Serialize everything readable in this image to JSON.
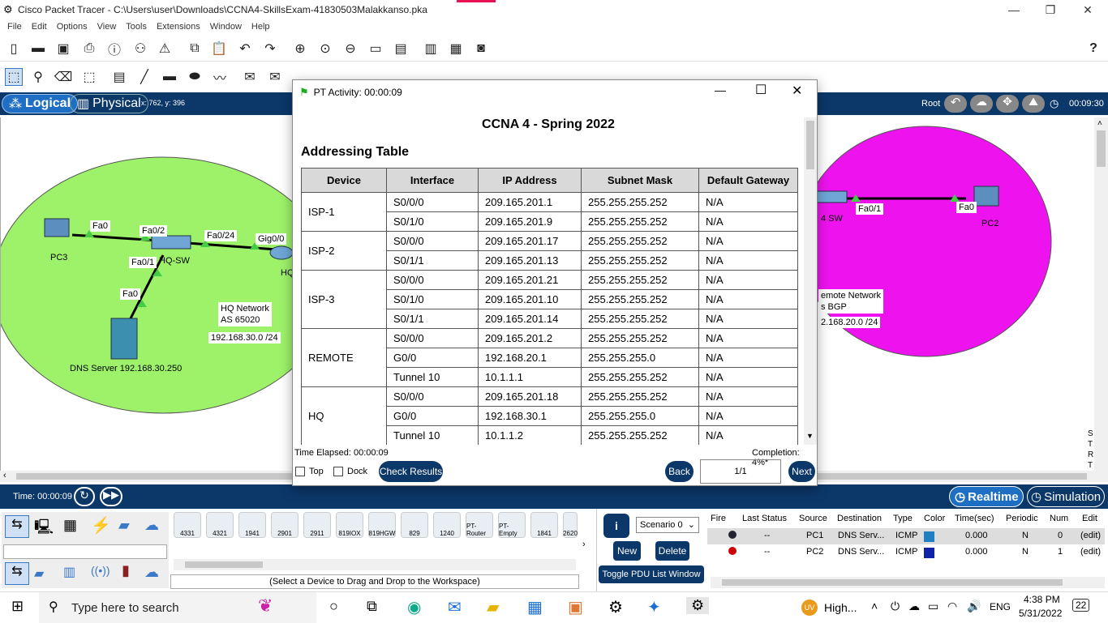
{
  "window": {
    "title": "Cisco Packet Tracer - C:\\Users\\user\\Downloads\\CCNA4-SkillsExam-41830503Malakkanso.pka",
    "min": "—",
    "restore": "❐",
    "close": "✕"
  },
  "menu": [
    "File",
    "Edit",
    "Options",
    "View",
    "Tools",
    "Extensions",
    "Window",
    "Help"
  ],
  "help_icon": "?",
  "logical": {
    "logical_label": "Logical",
    "physical_label": "Physical",
    "coords": "x: 762, y: 396",
    "root": "Root",
    "clock": "00:09:30"
  },
  "workspace": {
    "left": {
      "pc3": "PC3",
      "fa0_pc3": "Fa0",
      "fa02": "Fa0/2",
      "fa024": "Fa0/24",
      "gig00": "Gig0/0",
      "fa01": "Fa0/1",
      "hqsw": "HQ-SW",
      "hq": "HQ",
      "fa0_dns": "Fa0",
      "hqnet1": "HQ Network",
      "hqnet2": "AS 65020",
      "subnet": "192.168.30.0 /24",
      "dns": "DNS Server  192.168.30.250"
    },
    "right": {
      "sw": "4 SW",
      "fa01": "Fa0/1",
      "fa0": "Fa0",
      "pc2": "PC2",
      "remote1": "emote Network",
      "remote2": "s BGP",
      "subnet": "2.168.20.0 /24"
    },
    "side_letters": [
      "S",
      "T",
      "R",
      "T"
    ]
  },
  "timebar": {
    "time": "Time: 00:00:09",
    "realtime": "Realtime",
    "simulation": "Simulation"
  },
  "devices": [
    "4331",
    "4321",
    "1941",
    "2901",
    "2911",
    "819IOX",
    "819HGW",
    "829",
    "1240",
    "PT-Router",
    "PT-Empty",
    "1841",
    "2620"
  ],
  "device_hint": "(Select a Device to Drag and Drop to the Workspace)",
  "scenario": {
    "select": "Scenario 0",
    "new": "New",
    "delete": "Delete",
    "toggle": "Toggle PDU List Window",
    "info": "i"
  },
  "pdu": {
    "headers": [
      "Fire",
      "Last Status",
      "Source",
      "Destination",
      "Type",
      "Color",
      "Time(sec)",
      "Periodic",
      "Num",
      "Edit"
    ],
    "rows": [
      {
        "status": "--",
        "source": "PC1",
        "dest": "DNS Serv...",
        "type": "ICMP",
        "color": "#1e7fc2",
        "time": "0.000",
        "periodic": "N",
        "num": "0",
        "edit": "(edit)"
      },
      {
        "status": "--",
        "source": "PC2",
        "dest": "DNS Serv...",
        "type": "ICMP",
        "color": "#1022a8",
        "time": "0.000",
        "periodic": "N",
        "num": "1",
        "edit": "(edit)"
      }
    ]
  },
  "dialog": {
    "title": "PT Activity: 00:00:09",
    "heading": "CCNA 4 - Spring 2022",
    "section": "Addressing Table",
    "columns": [
      "Device",
      "Interface",
      "IP Address",
      "Subnet Mask",
      "Default Gateway"
    ],
    "devices": [
      {
        "name": "ISP-1",
        "rows": [
          [
            "S0/0/0",
            "209.165.201.1",
            "255.255.255.252",
            "N/A"
          ],
          [
            "S0/1/0",
            "209.165.201.9",
            "255.255.255.252",
            "N/A"
          ]
        ]
      },
      {
        "name": "ISP-2",
        "rows": [
          [
            "S0/0/0",
            "209.165.201.17",
            "255.255.255.252",
            "N/A"
          ],
          [
            "S0/1/1",
            "209.165.201.13",
            "255.255.255.252",
            "N/A"
          ]
        ]
      },
      {
        "name": "ISP-3",
        "rows": [
          [
            "S0/0/0",
            "209.165.201.21",
            "255.255.255.252",
            "N/A"
          ],
          [
            "S0/1/0",
            "209.165.201.10",
            "255.255.255.252",
            "N/A"
          ],
          [
            "S0/1/1",
            "209.165.201.14",
            "255.255.255.252",
            "N/A"
          ]
        ]
      },
      {
        "name": "REMOTE",
        "rows": [
          [
            "S0/0/0",
            "209.165.201.2",
            "255.255.255.252",
            "N/A"
          ],
          [
            "G0/0",
            "192.168.20.1",
            "255.255.255.0",
            "N/A"
          ],
          [
            "Tunnel 10",
            "10.1.1.1",
            "255.255.255.252",
            "N/A"
          ]
        ]
      },
      {
        "name": "HQ",
        "rows": [
          [
            "S0/0/0",
            "209.165.201.18",
            "255.255.255.252",
            "N/A"
          ],
          [
            "G0/0",
            "192.168.30.1",
            "255.255.255.0",
            "N/A"
          ],
          [
            "Tunnel 10",
            "10.1.1.2",
            "255.255.255.252",
            "N/A"
          ]
        ]
      }
    ],
    "elapsed": "Time Elapsed: 00:00:09",
    "completion": "Completion: 4%*",
    "top": "Top",
    "dock": "Dock",
    "check": "Check Results",
    "back": "Back",
    "page": "1/1",
    "next": "Next"
  },
  "taskbar": {
    "search": "Type here to search",
    "weather": "High...",
    "lang": "ENG",
    "time": "4:38 PM",
    "date": "5/31/2022",
    "notif": "22"
  }
}
